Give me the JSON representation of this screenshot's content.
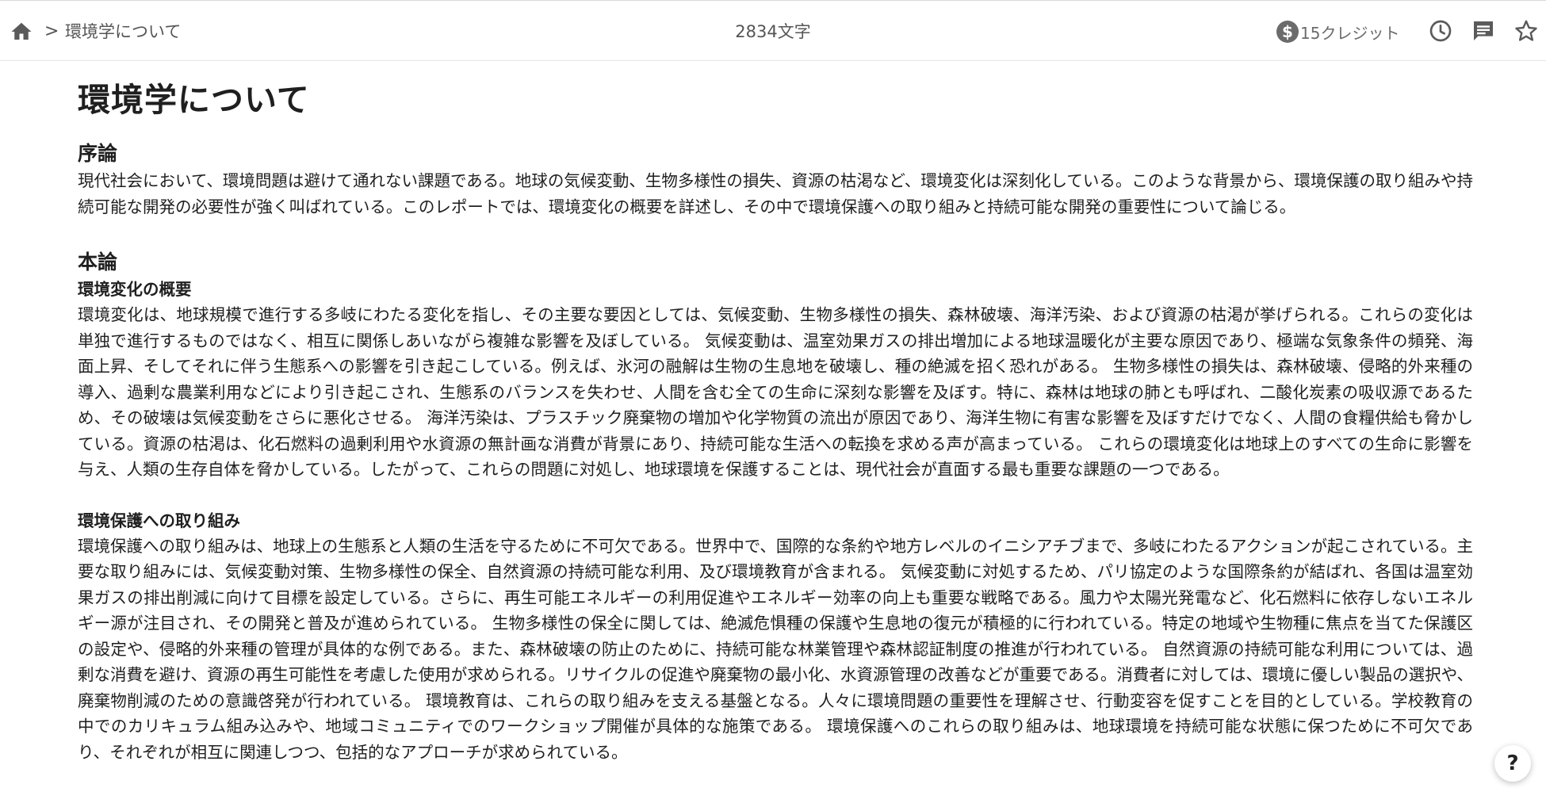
{
  "header": {
    "breadcrumb_sep": ">",
    "breadcrumb_label": "環境学について",
    "char_count": "2834文字",
    "credit_symbol": "$",
    "credit_text": "15クレジット"
  },
  "icons": {
    "home": "home-icon",
    "history": "clock-icon",
    "comment": "comment-icon",
    "favorite": "star-icon",
    "help": "help-icon"
  },
  "doc": {
    "title": "環境学について",
    "sections": [
      {
        "heading": "序論",
        "paragraph": "現代社会において、環境問題は避けて通れない課題である。地球の気候変動、生物多様性の損失、資源の枯渇など、環境変化は深刻化している。このような背景から、環境保護の取り組みや持続可能な開発の必要性が強く叫ばれている。このレポートでは、環境変化の概要を詳述し、その中で環境保護への取り組みと持続可能な開発の重要性について論じる。"
      },
      {
        "heading": "本論",
        "subsections": [
          {
            "heading": "環境変化の概要",
            "paragraph": "環境変化は、地球規模で進行する多岐にわたる変化を指し、その主要な要因としては、気候変動、生物多様性の損失、森林破壊、海洋汚染、および資源の枯渇が挙げられる。これらの変化は単独で進行するものではなく、相互に関係しあいながら複雑な影響を及ぼしている。 気候変動は、温室効果ガスの排出増加による地球温暖化が主要な原因であり、極端な気象条件の頻発、海面上昇、そしてそれに伴う生態系への影響を引き起こしている。例えば、氷河の融解は生物の生息地を破壊し、種の絶滅を招く恐れがある。 生物多様性の損失は、森林破壊、侵略的外来種の導入、過剰な農業利用などにより引き起こされ、生態系のバランスを失わせ、人間を含む全ての生命に深刻な影響を及ぼす。特に、森林は地球の肺とも呼ばれ、二酸化炭素の吸収源であるため、その破壊は気候変動をさらに悪化させる。 海洋汚染は、プラスチック廃棄物の増加や化学物質の流出が原因であり、海洋生物に有害な影響を及ぼすだけでなく、人間の食糧供給も脅かしている。資源の枯渇は、化石燃料の過剰利用や水資源の無計画な消費が背景にあり、持続可能な生活への転換を求める声が高まっている。 これらの環境変化は地球上のすべての生命に影響を与え、人類の生存自体を脅かしている。したがって、これらの問題に対処し、地球環境を保護することは、現代社会が直面する最も重要な課題の一つである。"
          },
          {
            "heading": "環境保護への取り組み",
            "paragraph": "環境保護への取り組みは、地球上の生態系と人類の生活を守るために不可欠である。世界中で、国際的な条約や地方レベルのイニシアチブまで、多岐にわたるアクションが起こされている。主要な取り組みには、気候変動対策、生物多様性の保全、自然資源の持続可能な利用、及び環境教育が含まれる。 気候変動に対処するため、パリ協定のような国際条約が結ばれ、各国は温室効果ガスの排出削減に向けて目標を設定している。さらに、再生可能エネルギーの利用促進やエネルギー効率の向上も重要な戦略である。風力や太陽光発電など、化石燃料に依存しないエネルギー源が注目され、その開発と普及が進められている。 生物多様性の保全に関しては、絶滅危惧種の保護や生息地の復元が積極的に行われている。特定の地域や生物種に焦点を当てた保護区の設定や、侵略的外来種の管理が具体的な例である。また、森林破壊の防止のために、持続可能な林業管理や森林認証制度の推進が行われている。 自然資源の持続可能な利用については、過剰な消費を避け、資源の再生可能性を考慮した使用が求められる。リサイクルの促進や廃棄物の最小化、水資源管理の改善などが重要である。消費者に対しては、環境に優しい製品の選択や、廃棄物削減のための意識啓発が行われている。 環境教育は、これらの取り組みを支える基盤となる。人々に環境問題の重要性を理解させ、行動変容を促すことを目的としている。学校教育の中でのカリキュラム組み込みや、地域コミュニティでのワークショップ開催が具体的な施策である。 環境保護へのこれらの取り組みは、地球環境を持続可能な状態に保つために不可欠であり、それぞれが相互に関連しつつ、包括的なアプローチが求められている。"
          }
        ]
      }
    ]
  },
  "help": {
    "label": "?"
  }
}
